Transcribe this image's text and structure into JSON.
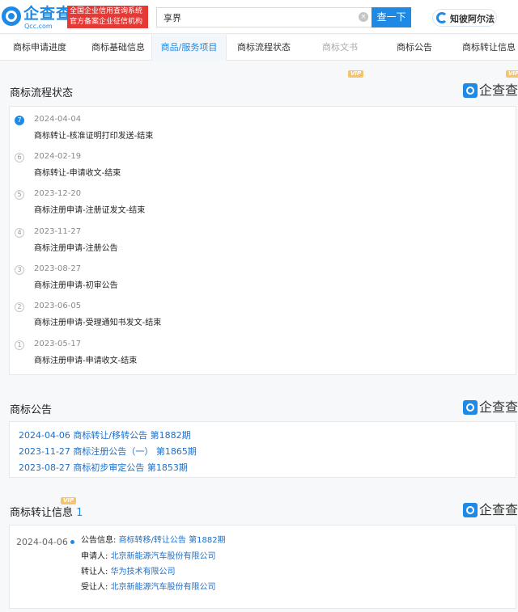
{
  "header": {
    "logo_text": "企查查",
    "logo_sub": "Qcc.com",
    "badge_line1": "全国企业信用查询系统",
    "badge_line2": "官方备案企业征信机构",
    "search_value": "享界",
    "search_button": "查一下",
    "clear_glyph": "×",
    "zhipo_label": "知彼阿尔法"
  },
  "tabs": [
    {
      "label": "商标申请进度"
    },
    {
      "label": "商标基础信息"
    },
    {
      "label": "商品/服务项目"
    },
    {
      "label": "商标流程状态"
    },
    {
      "label": "商标文书"
    },
    {
      "label": "商标公告"
    },
    {
      "label": "商标转让信息"
    }
  ],
  "vip_label": "VIP",
  "brand_mark_text": "企查查",
  "flow": {
    "title": "商标流程状态",
    "items": [
      {
        "num": "7",
        "date": "2024-04-04",
        "text": "商标转让-核准证明打印发送-结束"
      },
      {
        "num": "6",
        "date": "2024-02-19",
        "text": "商标转让-申请收文-结束"
      },
      {
        "num": "5",
        "date": "2023-12-20",
        "text": "商标注册申请-注册证发文-结束"
      },
      {
        "num": "4",
        "date": "2023-11-27",
        "text": "商标注册申请-注册公告"
      },
      {
        "num": "3",
        "date": "2023-08-27",
        "text": "商标注册申请-初审公告"
      },
      {
        "num": "2",
        "date": "2023-06-05",
        "text": "商标注册申请-受理通知书发文-结束"
      },
      {
        "num": "1",
        "date": "2023-05-17",
        "text": "商标注册申请-申请收文-结束"
      }
    ]
  },
  "announcements": {
    "title": "商标公告",
    "items": [
      "2024-04-06 商标转让/移转公告 第1882期",
      "2023-11-27 商标注册公告（一） 第1865期",
      "2023-08-27 商标初步审定公告 第1853期"
    ]
  },
  "transfer": {
    "title": "商标转让信息",
    "count": "1",
    "date": "2024-04-06",
    "rows": [
      {
        "key": "公告信息:",
        "value": "商标转移/转让公告 第1882期"
      },
      {
        "key": "申请人:",
        "value": "北京新能源汽车股份有限公司"
      },
      {
        "key": "转让人:",
        "value": "华为技术有限公司"
      },
      {
        "key": "受让人:",
        "value": "北京新能源汽车股份有限公司"
      }
    ]
  }
}
